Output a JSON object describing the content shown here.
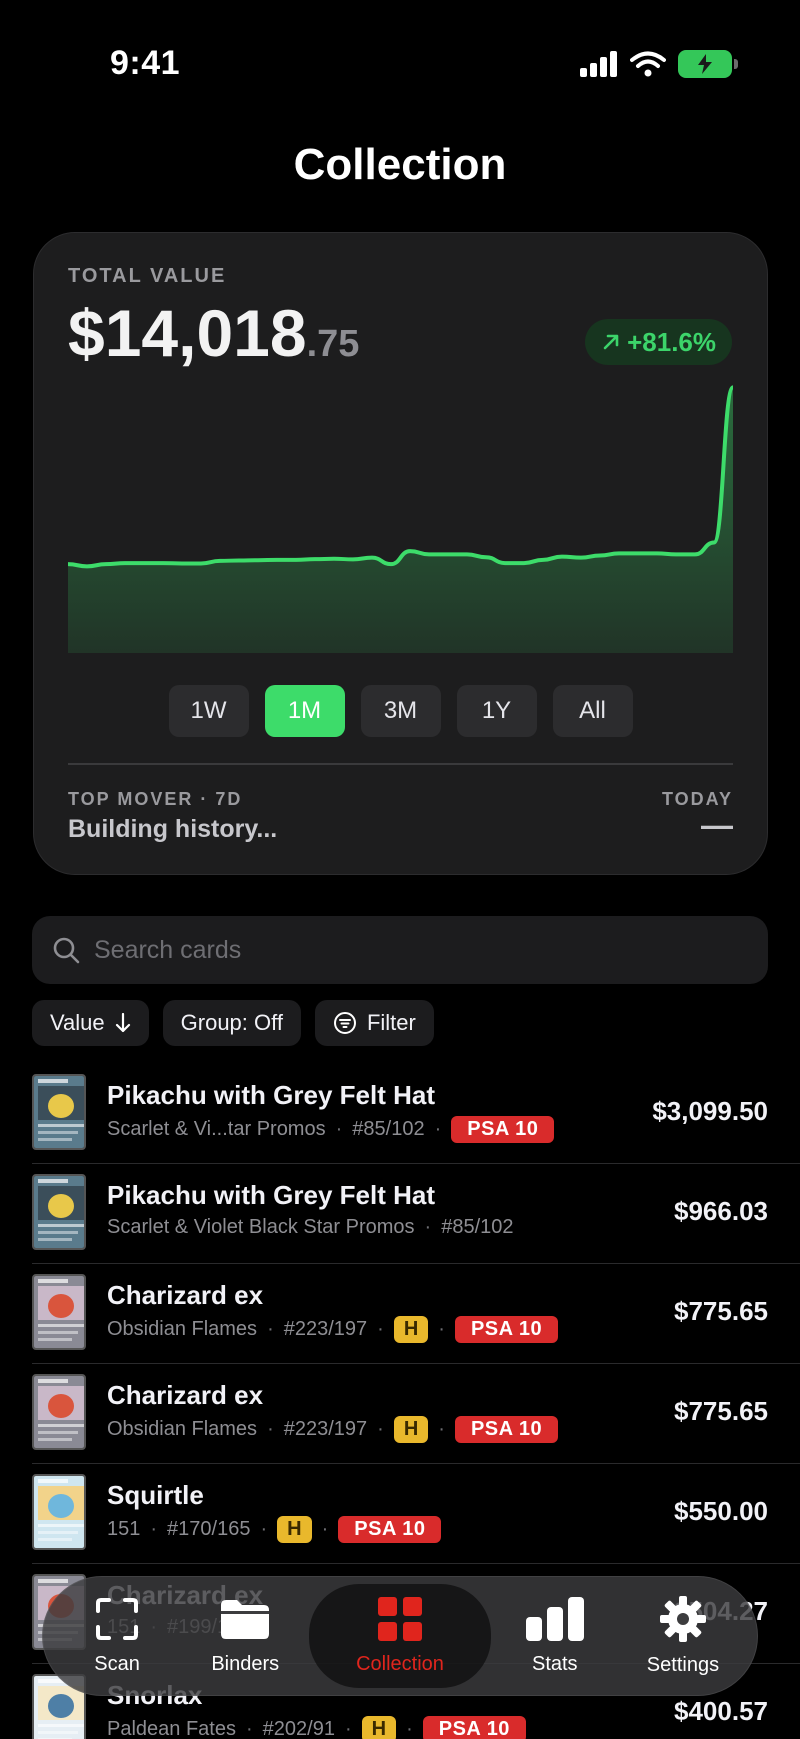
{
  "status": {
    "time": "9:41"
  },
  "page": {
    "title": "Collection"
  },
  "value_card": {
    "label": "TOTAL VALUE",
    "dollars": "$14,018",
    "cents": ".75",
    "change": "+81.6%",
    "ranges": [
      "1W",
      "1M",
      "3M",
      "1Y",
      "All"
    ],
    "active_range": "1M",
    "top_mover_label": "TOP MOVER · 7D",
    "top_mover_value": "Building history...",
    "today_label": "TODAY",
    "today_value": "—",
    "accent": "#3ddc6a"
  },
  "chart_data": {
    "type": "area",
    "color": "#3ddc6a",
    "values": [
      100,
      99,
      100,
      100.5,
      100.5,
      100.5,
      100.3,
      100.3,
      101.5,
      101.7,
      101.8,
      102,
      102,
      102.3,
      102.5,
      102.2,
      103,
      100,
      106,
      104.5,
      104.5,
      104.5,
      103.2,
      100.5,
      100.5,
      102,
      103.5,
      103,
      104,
      105,
      105,
      105,
      104.5,
      104.5,
      110,
      181.6
    ]
  },
  "search": {
    "placeholder": "Search cards"
  },
  "chips": {
    "sort": "Value",
    "group": "Group: Off",
    "filter": "Filter"
  },
  "cards": [
    {
      "name": "Pikachu with Grey Felt Hat",
      "set": "Scarlet & Vi...tar Promos",
      "number": "#85/102",
      "holo": null,
      "grade": "PSA 10",
      "price": "$3,099.50",
      "art": "pikachu"
    },
    {
      "name": "Pikachu with Grey Felt Hat",
      "set": "Scarlet & Violet Black Star Promos",
      "number": "#85/102",
      "holo": null,
      "grade": null,
      "price": "$966.03",
      "art": "pikachu"
    },
    {
      "name": "Charizard ex",
      "set": "Obsidian Flames",
      "number": "#223/197",
      "holo": "H",
      "grade": "PSA 10",
      "price": "$775.65",
      "art": "charizard"
    },
    {
      "name": "Charizard ex",
      "set": "Obsidian Flames",
      "number": "#223/197",
      "holo": "H",
      "grade": "PSA 10",
      "price": "$775.65",
      "art": "charizard"
    },
    {
      "name": "Squirtle",
      "set": "151",
      "number": "#170/165",
      "holo": "H",
      "grade": "PSA 10",
      "price": "$550.00",
      "art": "squirtle"
    },
    {
      "name": "Charizard ex",
      "set": "151",
      "number": "#199/165",
      "holo": null,
      "grade": null,
      "price": "$504.27",
      "art": "charizard"
    },
    {
      "name": "Snorlax",
      "set": "Paldean Fates",
      "number": "#202/91",
      "holo": "H",
      "grade": "PSA 10",
      "price": "$400.57",
      "art": "snorlax"
    }
  ],
  "tabs": [
    {
      "label": "Scan",
      "icon": "scan-icon"
    },
    {
      "label": "Binders",
      "icon": "folder-icon"
    },
    {
      "label": "Collection",
      "icon": "grid-icon",
      "active": true
    },
    {
      "label": "Stats",
      "icon": "bar-chart-icon"
    },
    {
      "label": "Settings",
      "icon": "gear-icon"
    }
  ]
}
